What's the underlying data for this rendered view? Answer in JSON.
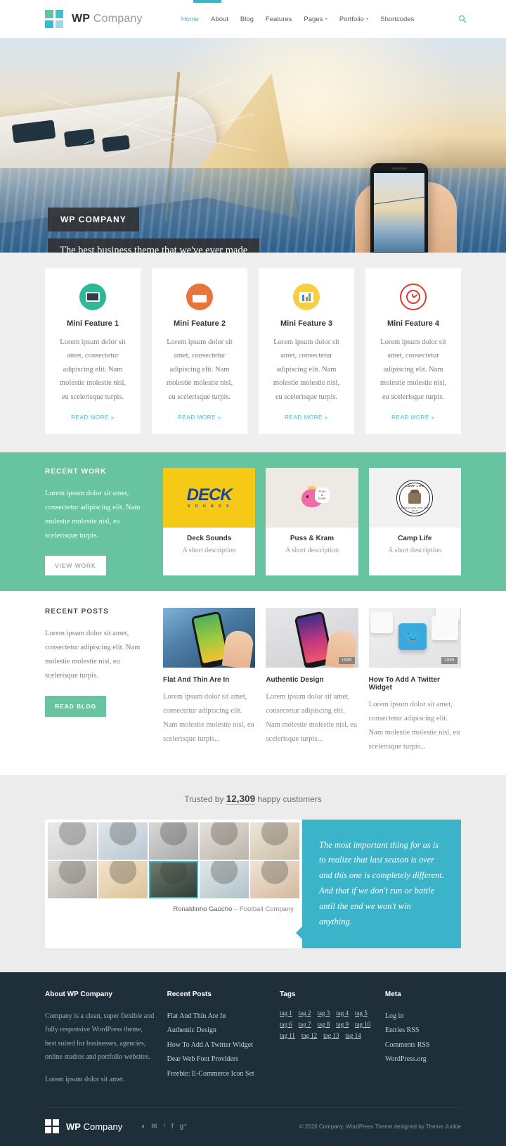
{
  "colors": {
    "accent": "#3ec0d3",
    "green": "#67c3a0",
    "teal_quote": "#3bb4c9",
    "footer_bg": "#1e2f3a",
    "yellow": "#f6c917"
  },
  "header": {
    "logo": {
      "bold": "WP",
      "light": "Company"
    },
    "nav": [
      {
        "label": "Home",
        "active": true,
        "caret": ""
      },
      {
        "label": "About",
        "active": false,
        "caret": ""
      },
      {
        "label": "Blog",
        "active": false,
        "caret": ""
      },
      {
        "label": "Features",
        "active": false,
        "caret": ""
      },
      {
        "label": "Pages",
        "active": false,
        "caret": "▾"
      },
      {
        "label": "Portfolio",
        "active": false,
        "caret": "▾"
      },
      {
        "label": "Shortcodes",
        "active": false,
        "caret": ""
      }
    ],
    "search_icon": "⚲"
  },
  "hero": {
    "title": "WP COMPANY",
    "subtitle": "The best business theme that we've ever made"
  },
  "features": {
    "read_more": "READ MORE »",
    "items": [
      {
        "title": "Mini Feature 1",
        "text": "Lorem ipsum dolor sit amet, consectetur adipiscing elit. Nam molestie molestie nisl, eu scelerisque turpis.",
        "icon": "monitor-icon"
      },
      {
        "title": "Mini Feature 2",
        "text": "Lorem ipsum dolor sit amet, consectetur adipiscing elit. Nam molestie molestie nisl, eu scelerisque turpis.",
        "icon": "browser-window-icon"
      },
      {
        "title": "Mini Feature 3",
        "text": "Lorem ipsum dolor sit amet, consectetur adipiscing elit. Nam molestie molestie nisl, eu scelerisque turpis.",
        "icon": "presentation-chart-icon"
      },
      {
        "title": "Mini Feature 4",
        "text": "Lorem ipsum dolor sit amet, consectetur adipiscing elit. Nam molestie molestie nisl, eu scelerisque turpis.",
        "icon": "clock-icon"
      }
    ]
  },
  "work": {
    "heading": "RECENT WORK",
    "text": "Lorem ipsum dolor sit amet, consectetur adipiscing elit. Nam molestie molestie nisl, eu scelerisque turpis.",
    "button": "VIEW WORK",
    "items": [
      {
        "name": "Deck Sounds",
        "desc": "A short description",
        "logo_main": "DECK",
        "logo_sub": "S O U N D S"
      },
      {
        "name": "Puss & Kram",
        "desc": "A short description",
        "bubble": "Puss & Kram"
      },
      {
        "name": "Camp Life",
        "desc": "A short description",
        "badge_top": "CAMP LIFE",
        "badge_bottom": "ADVENTURE INTO THE WILD"
      }
    ]
  },
  "posts": {
    "heading": "RECENT POSTS",
    "text": "Lorem ipsum dolor sit amet, consectetur adipiscing elit. Nam molestie molestie nisl, eu scelerisque turpis.",
    "button": "READ BLOG",
    "items": [
      {
        "title": "Flat And Thin Are In",
        "excerpt": "Lorem ipsum dolor sit amet, consectetur adipiscing elit. Nam molestie molestie nisl, eu scelerisque turpis...",
        "stamp": ""
      },
      {
        "title": "Authentic Design",
        "excerpt": "Lorem ipsum dolor sit amet, consectetur adipiscing elit. Nam molestie molestie nisl, eu scelerisque turpis...",
        "stamp": "1995"
      },
      {
        "title": "How To Add A Twitter Widget",
        "excerpt": "Lorem ipsum dolor sit amet, consectetur adipiscing elit. Nam molestie molestie nisl, eu scelerisque turpis...",
        "stamp": "1995"
      }
    ]
  },
  "testimonials": {
    "trust_prefix": "Trusted by",
    "trust_count": "12,309",
    "trust_suffix": "happy customers",
    "author": "Ronaldinho Gaúcho",
    "author_sep": "–",
    "author_company": "Football Company",
    "quote": "The most important thing for us is to realize that last season is over and this one is completely different. And that if we don't run or battle until the end we won't win anything.",
    "avatars": [
      {
        "name": "avatar-1",
        "active": false
      },
      {
        "name": "avatar-2",
        "active": false
      },
      {
        "name": "avatar-3",
        "active": false
      },
      {
        "name": "avatar-4",
        "active": false
      },
      {
        "name": "avatar-5",
        "active": false
      },
      {
        "name": "avatar-6",
        "active": false
      },
      {
        "name": "avatar-7",
        "active": false
      },
      {
        "name": "avatar-8",
        "active": true
      },
      {
        "name": "avatar-9",
        "active": false
      },
      {
        "name": "avatar-10",
        "active": false
      }
    ]
  },
  "footer": {
    "about": {
      "heading": "About WP Company",
      "p1": "Company is a clean, super flexible and fully responsive WordPress theme, best suited for businesses, agencies, online studios and portfolio websites.",
      "p2": "Lorem ipsum dolor sit amet."
    },
    "recent": {
      "heading": "Recent Posts",
      "items": [
        "Flat And Thin Are In",
        "Authentic Design",
        "How To Add A Twitter Widget",
        "Dear Web Font Providers",
        "Freebie: E-Commerce Icon Set"
      ]
    },
    "tags": {
      "heading": "Tags",
      "items": [
        "tag 1",
        "tag 2",
        "tag 3",
        "tag 4",
        "tag 5",
        "tag 6",
        "tag 7",
        "tag 8",
        "tag 9",
        "tag 10",
        "tag 11",
        "tag 12",
        "tag 13",
        "tag 14"
      ]
    },
    "meta": {
      "heading": "Meta",
      "items": [
        "Log in",
        "Entries RSS",
        "Comments RSS",
        "WordPress.org"
      ]
    },
    "logo": {
      "bold": "WP",
      "light": "Company"
    },
    "social": [
      {
        "name": "rss-icon",
        "glyph": "◖"
      },
      {
        "name": "email-icon",
        "glyph": "✉"
      },
      {
        "name": "twitter-icon",
        "glyph": "ᵗ"
      },
      {
        "name": "facebook-icon",
        "glyph": "f"
      },
      {
        "name": "googleplus-icon",
        "glyph": "g⁺"
      }
    ],
    "copyright": "© 2016 Company. WordPress Theme designed by Theme Junkie"
  }
}
